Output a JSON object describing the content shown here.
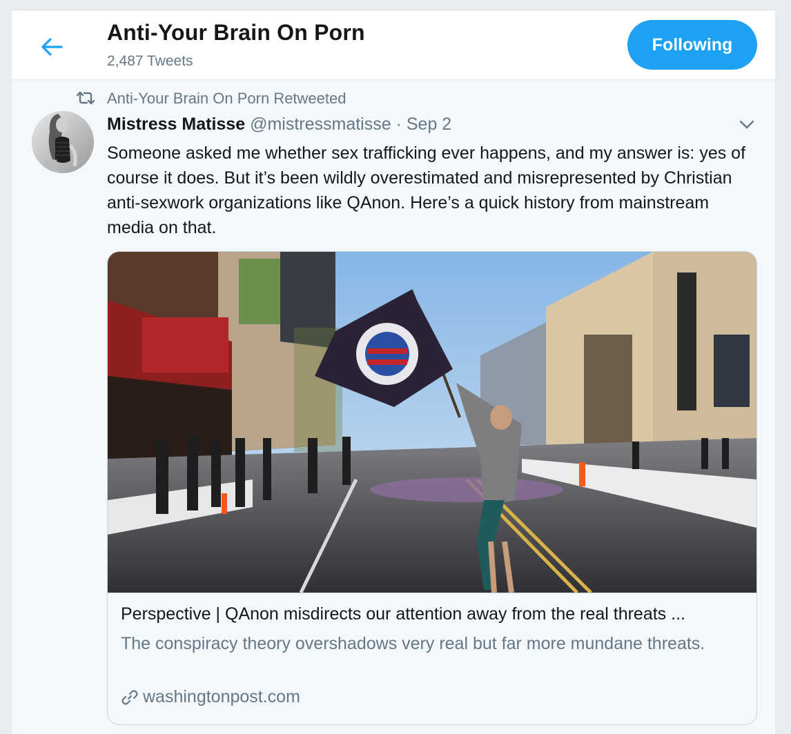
{
  "header": {
    "profile_name": "Anti-Your Brain On Porn",
    "tweet_count": "2,487 Tweets",
    "follow_label": "Following"
  },
  "tweet": {
    "retweeted_by": "Anti-Your Brain On Porn Retweeted",
    "author_name": "Mistress Matisse",
    "author_handle": "@mistressmatisse",
    "separator": "·",
    "date": "Sep 2",
    "text": "Someone asked me whether sex trafficking ever happens, and my answer is: yes of course it does. But it’s been wildly overestimated and misrepresented by Christian anti-sexwork organizations like QAnon. Here’s a quick history from mainstream media on that."
  },
  "card": {
    "title": "Perspective | QAnon misdirects our attention away from the real threats ...",
    "description": "The conspiracy theory overshadows very real but far more mundane threats.",
    "domain": "washingtonpost.com"
  },
  "icons": {
    "back": "arrow-left-icon",
    "retweet": "retweet-icon",
    "caret": "chevron-down-icon",
    "link": "link-icon"
  },
  "colors": {
    "accent": "#1da1f2",
    "secondary_text": "#657786",
    "tweet_bg": "#f5f8fa",
    "page_bg": "#e6ecf0"
  }
}
